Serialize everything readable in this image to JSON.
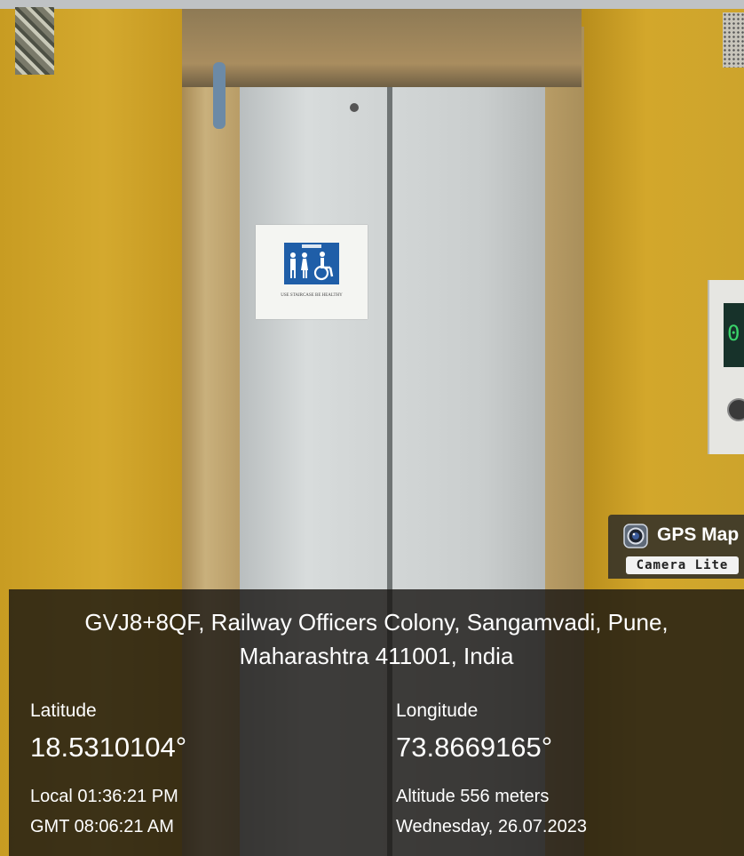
{
  "badge": {
    "icon": "camera-lens-icon",
    "title": "GPS Map",
    "subtitle": "Camera Lite"
  },
  "sign": {
    "icon": "restroom-accessible-icon",
    "text": "USE STAIRCASE BE HEALTHY"
  },
  "call_panel": {
    "display_digit": "0",
    "button_icon": "call-button-icon"
  },
  "overlay": {
    "address_line1": "GVJ8+8QF, Railway Officers Colony, Sangamvadi, Pune,",
    "address_line2": "Maharashtra 411001, India",
    "latitude_label": "Latitude",
    "latitude_value": "18.5310104°",
    "longitude_label": "Longitude",
    "longitude_value": "73.8669165°",
    "local_time": "Local 01:36:21 PM",
    "gmt_time": "GMT 08:06:21 AM",
    "altitude": "Altitude 556 meters",
    "date": "Wednesday, 26.07.2023"
  }
}
